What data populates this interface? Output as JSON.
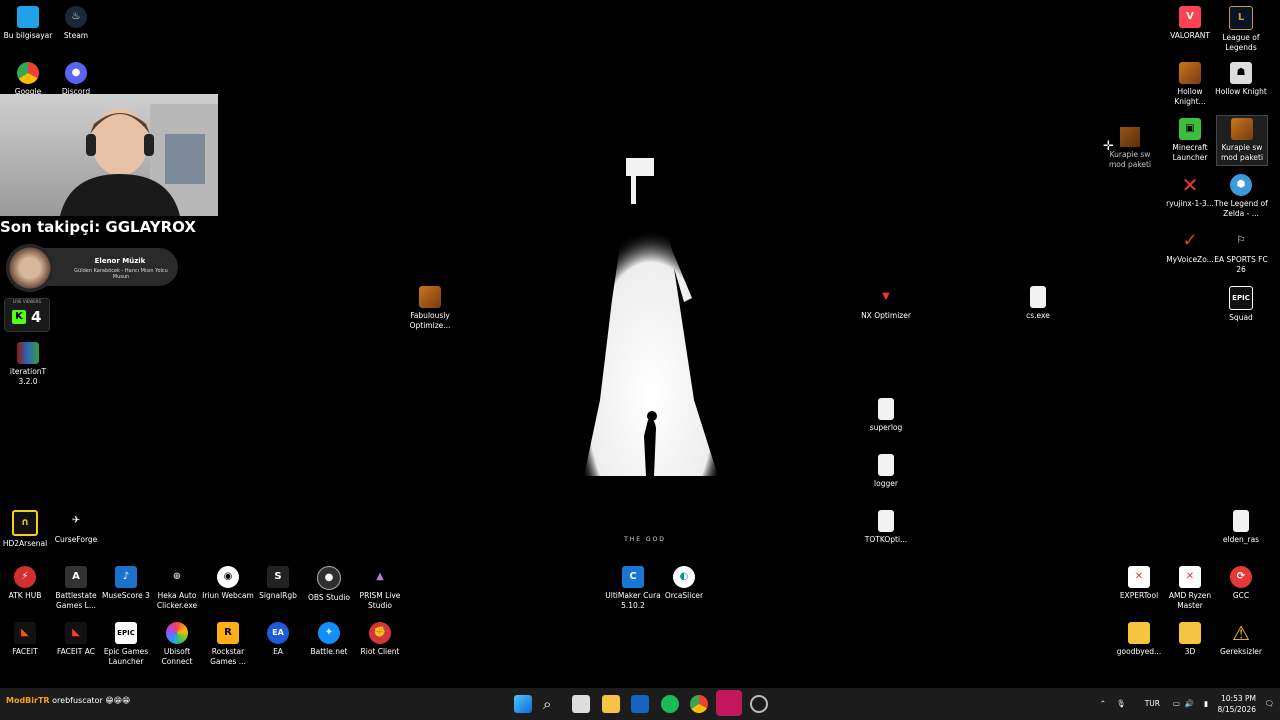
{
  "desktop_icons": {
    "bu_bilgisayar": "Bu bilgisayar",
    "steam": "Steam",
    "google": "Google",
    "discord": "Discord",
    "iterationt": "iterationT 3.2.0",
    "fabulously": "Fabulously Optimize...",
    "nx_optimizer": "NX Optimizer",
    "cs_exe": "cs.exe",
    "superlog": "superlog",
    "logger": "logger",
    "totkopti": "TOTKOpti...",
    "hd2arsenal": "HD2Arsenal",
    "curseforge": "CurseForge",
    "atk_hub": "ATK HUB",
    "battlestate": "Battlestate Games L...",
    "musescore": "MuseScore 3",
    "heka": "Heka Auto Clicker.exe",
    "iriun": "Iriun Webcam",
    "signalrgb": "SignalRgb",
    "obs": "OBS Studio",
    "prism": "PRISM Live Studio",
    "ultimaker": "UltiMaker Cura 5.10.2",
    "orcaslicer": "OrcaSlicer",
    "faceit": "FACEIT",
    "faceit_ac": "FACEIT AC",
    "epic_launcher": "Epic Games Launcher",
    "ubisoft": "Ubisoft Connect",
    "rockstar": "Rockstar Games ...",
    "ea": "EA",
    "battlenet": "Battle.net",
    "riot": "Riot Client",
    "valorant": "VALORANT",
    "lol": "League of Legends",
    "hollow1": "Hollow Knight...",
    "hollow2": "Hollow Knight",
    "minecraft": "Minecraft Launcher",
    "kurapie": "Kurapie sw mod paketi",
    "ryujinx": "ryujinx-1-3...",
    "zelda": "The Legend of Zelda - ...",
    "myvoice": "MyVoiceZo...",
    "eafc": "EA SPORTS FC 26",
    "squad": "Squad",
    "elden": "elden_ras",
    "experttool": "EXPERTool",
    "amd": "AMD Ryzen Master",
    "gcc": "GCC",
    "goodbyed": "goodbyed...",
    "d3": "3D",
    "gereksizler": "Gereksizler",
    "drag_ghost": "Kurapie sw mod paketi"
  },
  "overlay": {
    "follower": "Son takipçi: GGLAYROX",
    "music_title": "Elenor Müzik",
    "music_song": "Gülden Karaböcek - Hancı Mısın Yolcu Musun",
    "viewers_label": "LIVE VIEWERS",
    "kick_letter": "K",
    "viewers_count": "4"
  },
  "wallpaper": {
    "caption": "THE GOD"
  },
  "taskbar": {
    "ticker_user": "ModBirTR",
    "ticker_text": "orebfuscator 😁😁😁",
    "language": "TUR",
    "time": "10:53 PM",
    "date": "8/15/2026"
  },
  "colors": {
    "kick_green": "#53fc18",
    "taskbar_bg": "#1c1c1c",
    "ticker_user": "#f6a01a"
  }
}
